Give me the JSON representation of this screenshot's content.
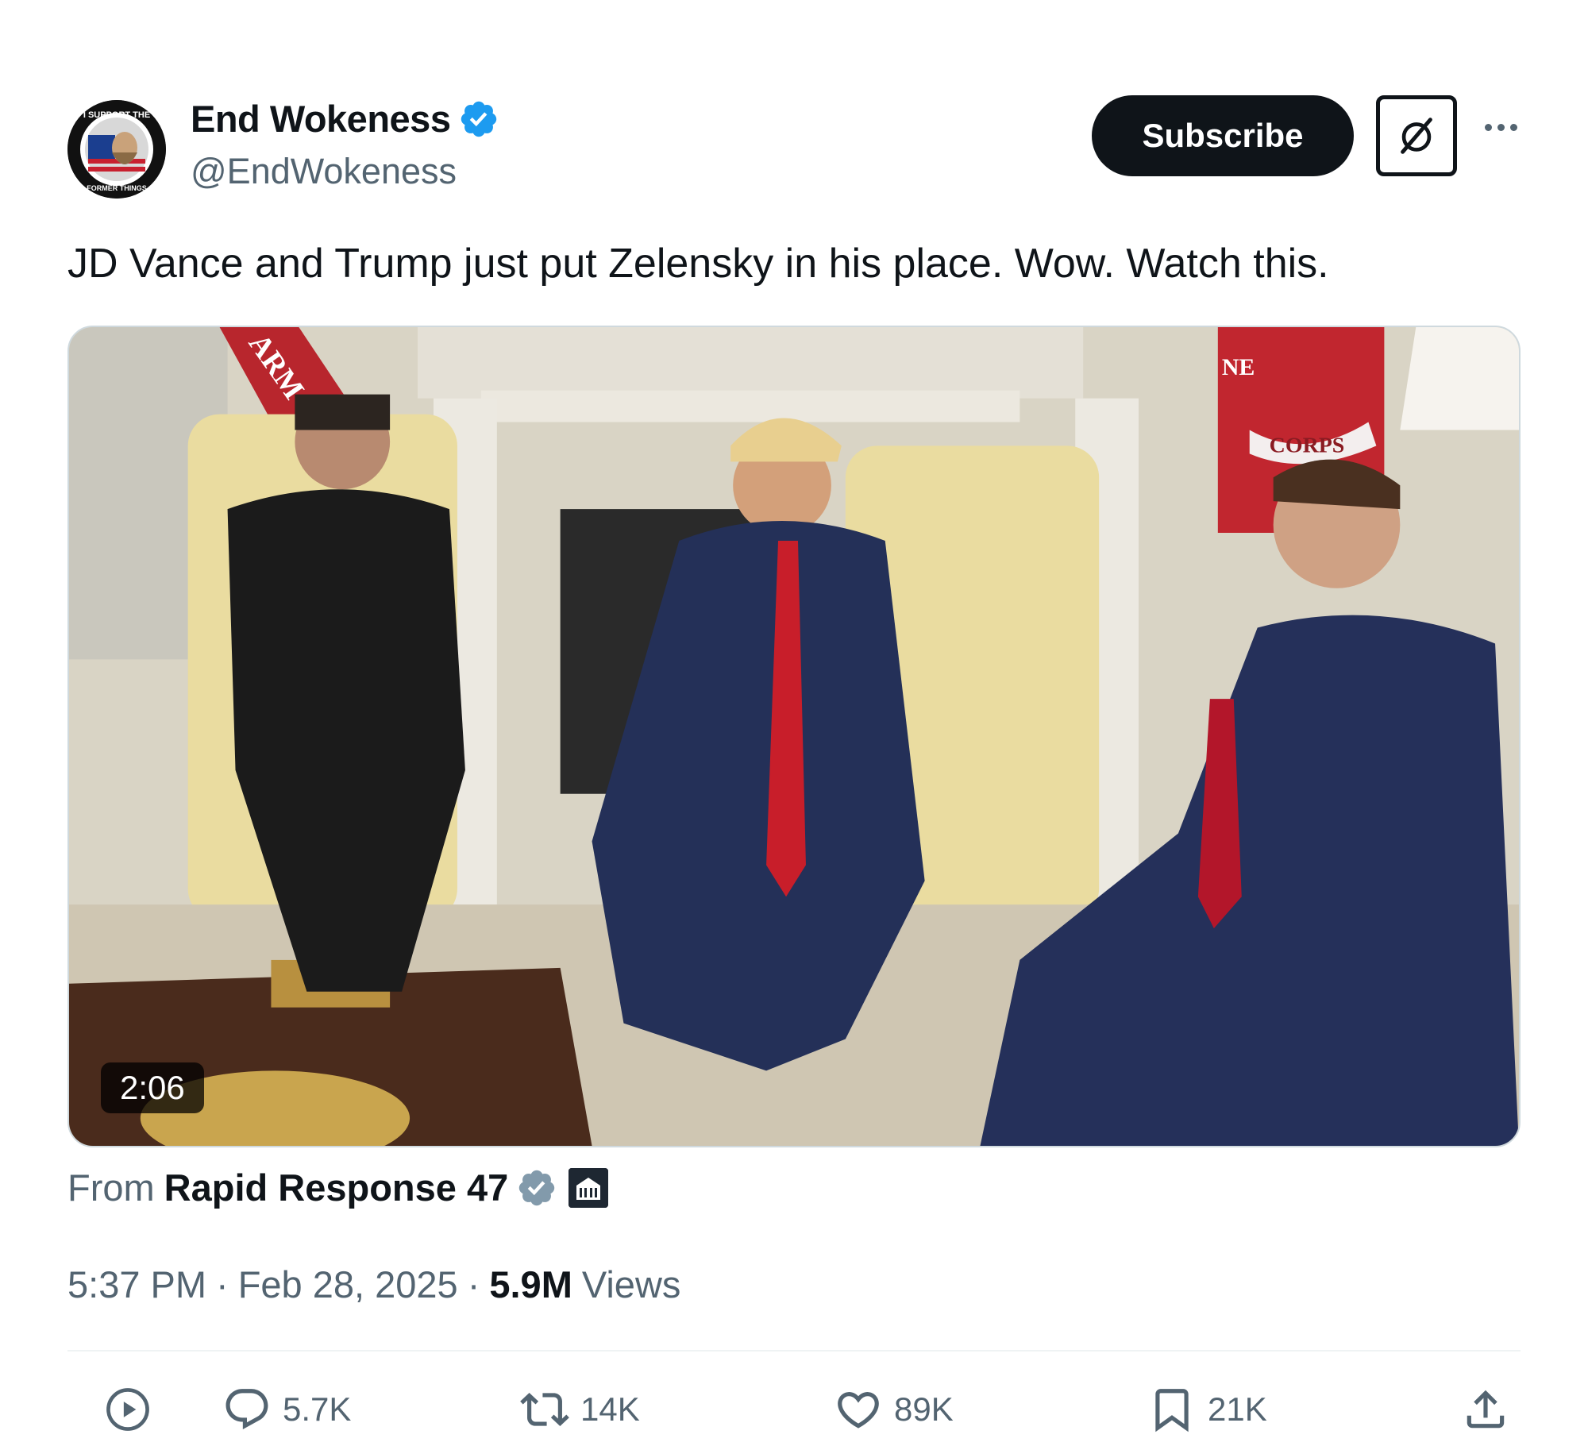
{
  "author": {
    "display_name": "End Wokeness",
    "handle": "@EndWokeness",
    "avatar_text_top": "I SUPPORT THE",
    "avatar_text_bottom": "FORMER THINGS"
  },
  "header": {
    "subscribe_label": "Subscribe"
  },
  "tweet": {
    "text": "JD Vance and Trump just put Zelensky in his place. Wow. Watch this."
  },
  "media": {
    "type": "video",
    "duration": "2:06",
    "flag_left_text": "ARM",
    "flag_right_text_top": "NE",
    "flag_right_text_banner": "CORPS"
  },
  "source": {
    "from_label": "From",
    "name": "Rapid Response 47"
  },
  "meta": {
    "time": "5:37 PM",
    "date": "Feb 28, 2025",
    "views_count": "5.9M",
    "views_label": "Views",
    "separator": "·"
  },
  "actions": {
    "replies": "5.7K",
    "reposts": "14K",
    "likes": "89K",
    "bookmarks": "21K"
  },
  "colors": {
    "text_primary": "#0f1419",
    "text_secondary": "#536471",
    "verified_blue": "#1d9bf0",
    "verified_gray": "#829aab",
    "divider": "#eff3f4"
  }
}
